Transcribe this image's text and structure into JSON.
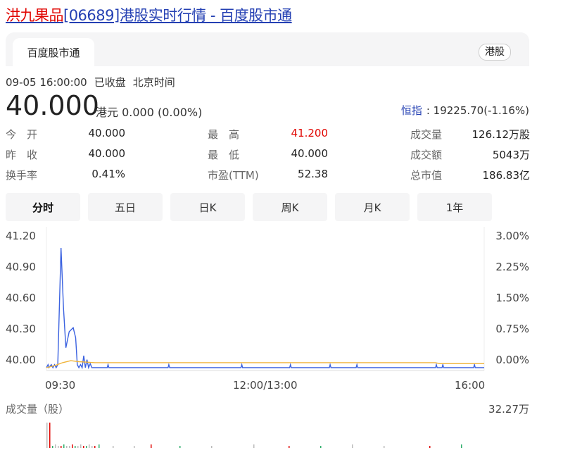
{
  "page": {
    "title_link": "洪九果品",
    "title_rest": "[06689]港股实时行情 - 百度股市通"
  },
  "panel": {
    "tab": "百度股市通",
    "tag": "港股"
  },
  "quote": {
    "date_time": "09-05 16:00:00",
    "status": "已收盘",
    "timezone": "北京时间",
    "price": "40.000",
    "currency": "港元",
    "change": "0.000 (0.00%)"
  },
  "index": {
    "name": "恒指",
    "value": ": 19225.70(-1.16%)"
  },
  "stats": [
    [
      {
        "label": "今　开",
        "value": "40.000"
      },
      {
        "label": "最　高",
        "value": "41.200",
        "color": "#e10602"
      },
      {
        "label": "成交量",
        "value": "126.12万股"
      }
    ],
    [
      {
        "label": "昨　收",
        "value": "40.000"
      },
      {
        "label": "最　低",
        "value": "40.000"
      },
      {
        "label": "成交额",
        "value": "5043万"
      }
    ],
    [
      {
        "label": "换手率",
        "value": "0.41%"
      },
      {
        "label": "市盈(TTM)",
        "value": "52.38"
      },
      {
        "label": "总市值",
        "value": "186.83亿"
      }
    ]
  ],
  "chart_tabs": [
    "分时",
    "五日",
    "日K",
    "周K",
    "月K",
    "1年"
  ],
  "chart_data": {
    "type": "line",
    "y_left_ticks": [
      "41.20",
      "40.90",
      "40.60",
      "40.30",
      "40.00"
    ],
    "y_right_ticks": [
      "3.00%",
      "2.25%",
      "1.50%",
      "0.75%",
      "0.00%"
    ],
    "x_ticks": [
      "09:30",
      "12:00/13:00",
      "16:00"
    ],
    "ylim": [
      40.0,
      41.2
    ],
    "series": [
      {
        "color": "#3b62e0",
        "points": [
          [
            0,
            40.0
          ],
          [
            2,
            40.03
          ],
          [
            3,
            40.0
          ],
          [
            6,
            40.03
          ],
          [
            8,
            40.0
          ],
          [
            10,
            40.03
          ],
          [
            12,
            40.0
          ],
          [
            14,
            40.03
          ],
          [
            18,
            41.2
          ],
          [
            21,
            40.6
          ],
          [
            24,
            40.2
          ],
          [
            28,
            40.36
          ],
          [
            33,
            40.4
          ],
          [
            36,
            40.3
          ],
          [
            38,
            40.03
          ],
          [
            40,
            40.0
          ],
          [
            42,
            40.03
          ],
          [
            44,
            40.0
          ],
          [
            46,
            40.12
          ],
          [
            48,
            40.0
          ],
          [
            50,
            40.08
          ],
          [
            52,
            40.0
          ],
          [
            54,
            40.04
          ],
          [
            56,
            40.0
          ],
          [
            75,
            40.0
          ],
          [
            76,
            40.03
          ],
          [
            77,
            40.0
          ],
          [
            150,
            40.0
          ],
          [
            151,
            40.03
          ],
          [
            152,
            40.0
          ],
          [
            240,
            40.0
          ],
          [
            241,
            40.03
          ],
          [
            242,
            40.0
          ],
          [
            300,
            40.0
          ],
          [
            301,
            40.03
          ],
          [
            302,
            40.0
          ],
          [
            349,
            40.0
          ],
          [
            350,
            40.03
          ],
          [
            351,
            40.0
          ],
          [
            382,
            40.0
          ],
          [
            383,
            40.03
          ],
          [
            384,
            40.0
          ],
          [
            480,
            40.0
          ],
          [
            481,
            40.03
          ],
          [
            482,
            40.0
          ],
          [
            488,
            40.0
          ],
          [
            489,
            40.03
          ],
          [
            490,
            40.0
          ],
          [
            527,
            40.0
          ],
          [
            528,
            40.03
          ],
          [
            529,
            40.0
          ],
          [
            540,
            40.0
          ]
        ]
      },
      {
        "color": "#f0b43a",
        "points": [
          [
            0,
            40.0
          ],
          [
            10,
            40.02
          ],
          [
            20,
            40.05
          ],
          [
            30,
            40.07
          ],
          [
            40,
            40.06
          ],
          [
            60,
            40.05
          ],
          [
            100,
            40.05
          ],
          [
            200,
            40.05
          ],
          [
            300,
            40.05
          ],
          [
            400,
            40.05
          ],
          [
            480,
            40.05
          ],
          [
            485,
            40.04
          ],
          [
            540,
            40.04
          ]
        ]
      }
    ]
  },
  "volume": {
    "title": "成交量（股）",
    "max": "32.27万"
  }
}
